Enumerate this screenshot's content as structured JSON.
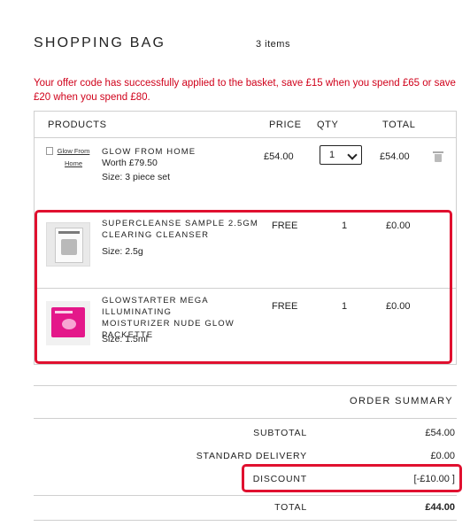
{
  "header": {
    "title": "SHOPPING BAG",
    "items_count": "3 items"
  },
  "offer_message": "Your offer code has successfully applied to the basket, save £15 when you spend £65 or save £20 when you spend £80.",
  "table": {
    "columns": {
      "products": "PRODUCTS",
      "price": "PRICE",
      "qty": "QTY",
      "total": "TOTAL"
    },
    "rows": [
      {
        "image_alt": "Glow From Home",
        "name": "GLOW FROM HOME",
        "worth": "Worth £79.50",
        "size": "Size: 3 piece set",
        "price": "£54.00",
        "qty": "1",
        "total": "£54.00"
      },
      {
        "name": "SUPERCLEANSE SAMPLE 2.5GM CLEARING CLEANSER",
        "size": "Size: 2.5g",
        "price": "FREE",
        "qty": "1",
        "total": "£0.00"
      },
      {
        "name": "GLOWSTARTER MEGA ILLUMINATING MOISTURIZER NUDE GLOW PACKETTE",
        "size": "Size: 1.5ml",
        "price": "FREE",
        "qty": "1",
        "total": "£0.00"
      }
    ]
  },
  "summary": {
    "title": "ORDER SUMMARY",
    "subtotal_label": "SUBTOTAL",
    "subtotal": "£54.00",
    "delivery_label": "STANDARD DELIVERY",
    "delivery": "£0.00",
    "discount_label": "DISCOUNT",
    "discount": "[-£10.00 ]",
    "total_label": "TOTAL",
    "total": "£44.00"
  },
  "colors": {
    "alert": "#d0021b",
    "highlight": "#e0102f",
    "pack_pink": "#e4188a"
  },
  "icons": {
    "delete": "trash-icon",
    "qty_dropdown": "chevron-down-icon"
  }
}
